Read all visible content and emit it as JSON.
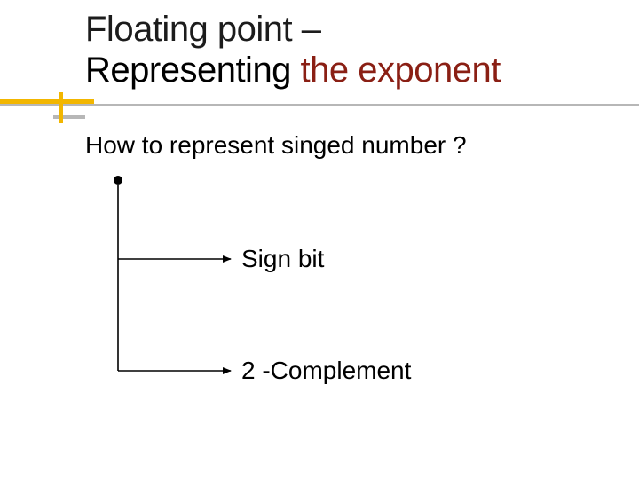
{
  "title": {
    "line1": "Floating point –",
    "line2_prefix": "Representing ",
    "line2_highlight": "the exponent"
  },
  "question": "How to represent singed number ?",
  "options": {
    "sign_bit": "Sign bit",
    "two_complement": "2 -Complement"
  },
  "colors": {
    "accent_yellow": "#f2b600",
    "accent_grey": "#b7b7b7",
    "title_highlight": "#8a1f14"
  }
}
